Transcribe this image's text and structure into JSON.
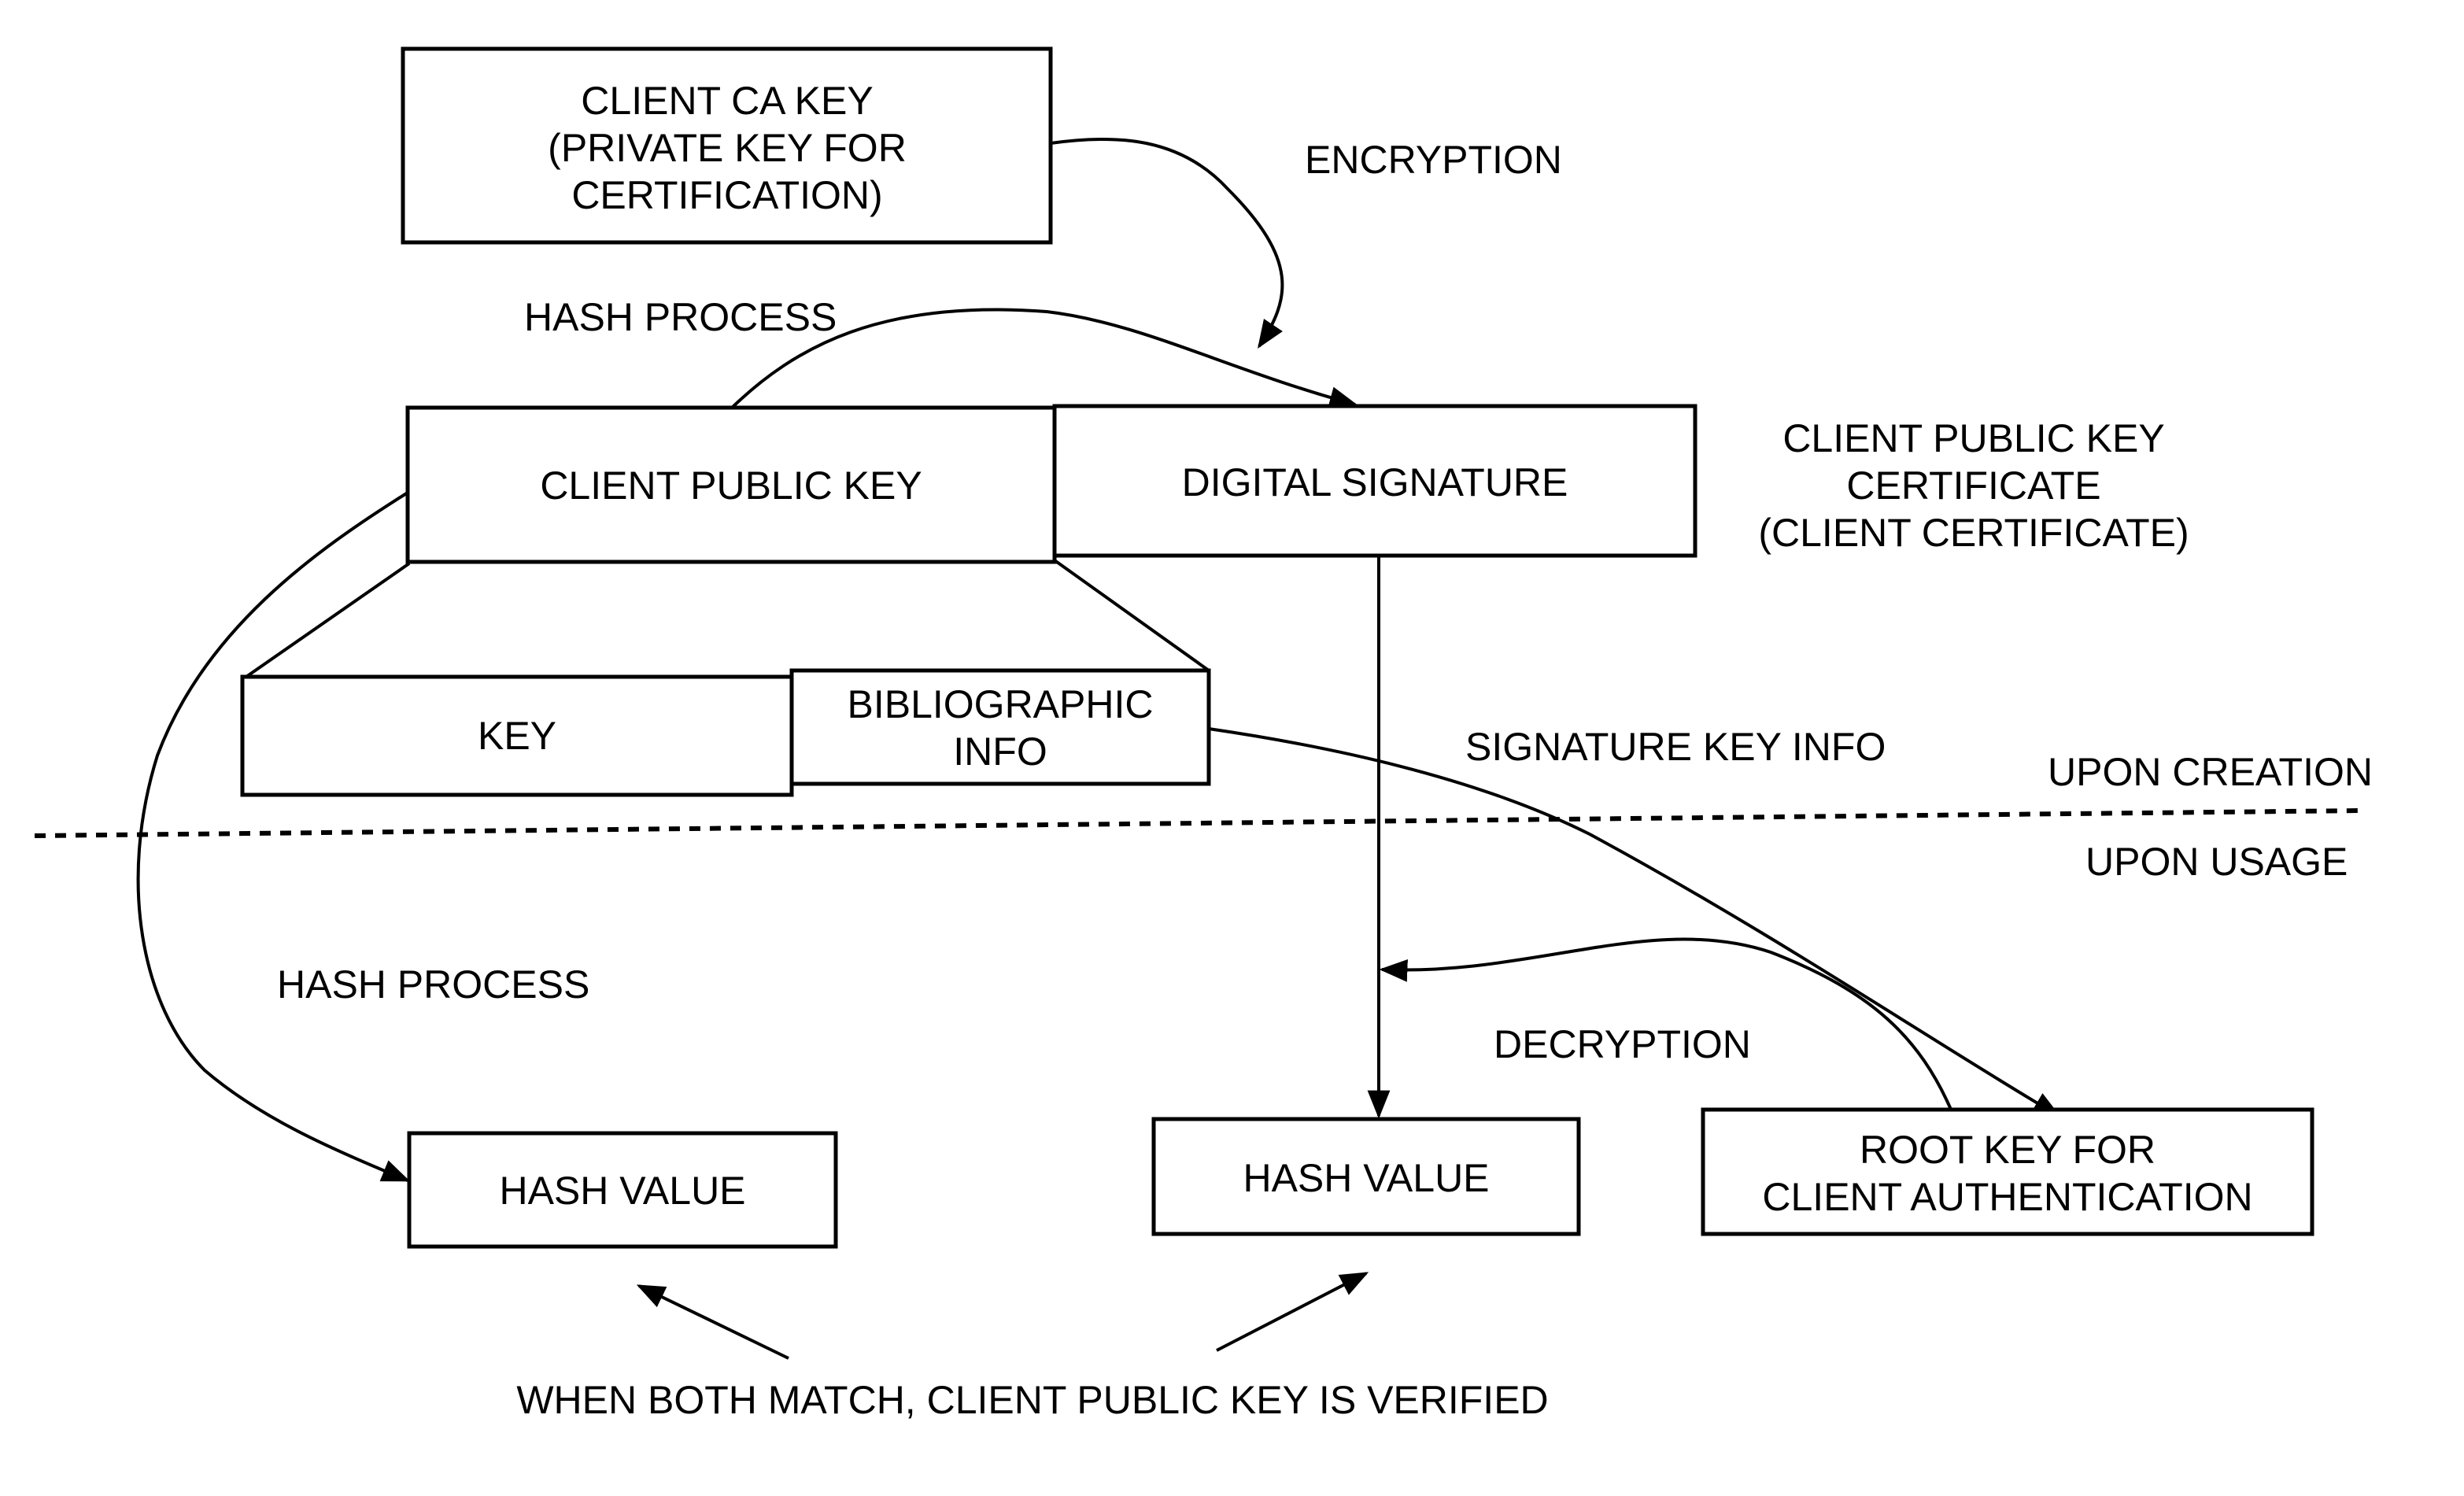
{
  "boxes": {
    "client_ca_key": {
      "lines": [
        "CLIENT CA KEY",
        "(PRIVATE KEY FOR",
        "CERTIFICATION)"
      ]
    },
    "client_public_key": {
      "label": "CLIENT PUBLIC KEY"
    },
    "digital_signature": {
      "label": "DIGITAL SIGNATURE"
    },
    "key": {
      "label": "KEY"
    },
    "bibliographic_info": {
      "lines": [
        "BIBLIOGRAPHIC",
        "INFO"
      ]
    },
    "hash_value_left": {
      "label": "HASH VALUE"
    },
    "hash_value_right": {
      "label": "HASH VALUE"
    },
    "root_key": {
      "lines": [
        "ROOT KEY FOR",
        "CLIENT AUTHENTICATION"
      ]
    }
  },
  "labels": {
    "encryption": "ENCRYPTION",
    "hash_process_top": "HASH PROCESS",
    "certificate": [
      "CLIENT PUBLIC KEY",
      "CERTIFICATE",
      "(CLIENT CERTIFICATE)"
    ],
    "signature_key_info": "SIGNATURE KEY INFO",
    "upon_creation": "UPON CREATION",
    "upon_usage": "UPON USAGE",
    "hash_process_bottom": "HASH PROCESS",
    "decryption": "DECRYPTION",
    "verification_note": "WHEN BOTH MATCH, CLIENT PUBLIC KEY IS VERIFIED"
  },
  "colors": {
    "ink": "#000000",
    "paper": "#ffffff"
  }
}
